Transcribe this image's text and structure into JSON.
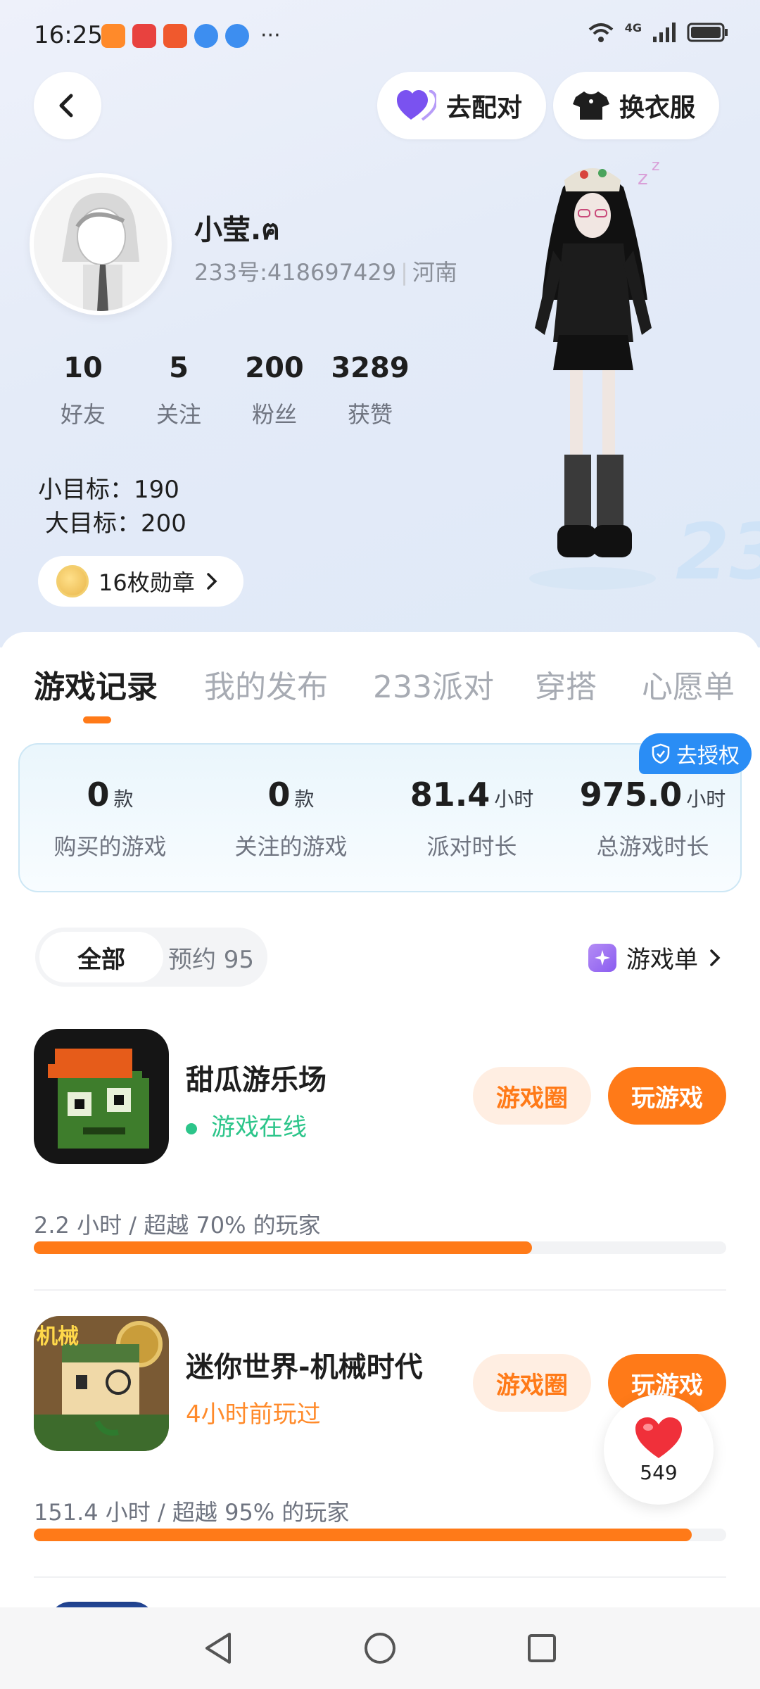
{
  "status_bar": {
    "time": "16:25",
    "network": "4G",
    "more": "···"
  },
  "header": {
    "back_label": "",
    "match_label": "去配对",
    "dress_label": "换衣服"
  },
  "profile": {
    "username": "小莹.ฅ",
    "id_text": "233号:418697429",
    "region": "河南",
    "stats": [
      {
        "num": "10",
        "label": "好友"
      },
      {
        "num": "5",
        "label": "关注"
      },
      {
        "num": "200",
        "label": "粉丝"
      },
      {
        "num": "3289",
        "label": "获赞"
      }
    ],
    "goal_small": "小目标：190",
    "goal_big": "大目标：200",
    "badges_label": "16枚勋章"
  },
  "tabs": [
    "游戏记录",
    "我的发布",
    "233派对",
    "穿搭",
    "心愿单"
  ],
  "summary": {
    "auth_label": "去授权",
    "cols": [
      {
        "value": "0",
        "unit": "款",
        "label": "购买的游戏"
      },
      {
        "value": "0",
        "unit": "款",
        "label": "关注的游戏"
      },
      {
        "value": "81.4",
        "unit": "小时",
        "label": "派对时长"
      },
      {
        "value": "975.0",
        "unit": "小时",
        "label": "总游戏时长"
      }
    ]
  },
  "filter": {
    "all_label": "全部",
    "reserve_label": "预约 95",
    "game_list_label": "游戏单"
  },
  "games": [
    {
      "name": "甜瓜游乐场",
      "status": "游戏在线",
      "circle_label": "游戏圈",
      "play_label": "玩游戏",
      "meta": "2.2 小时 / 超越 70% 的玩家",
      "progress": 0.72
    },
    {
      "name": "迷你世界-机械时代",
      "status": "4小时前玩过",
      "circle_label": "游戏圈",
      "play_label": "玩游戏",
      "meta": "151.4 小时 / 超越 95% 的玩家",
      "progress": 0.95,
      "icon_text": "机械"
    }
  ],
  "like": {
    "count": "549"
  },
  "colors": {
    "accent": "#ff7a18",
    "online": "#2cc58a",
    "recent": "#ff8a2a",
    "auth": "#2a8df5"
  }
}
